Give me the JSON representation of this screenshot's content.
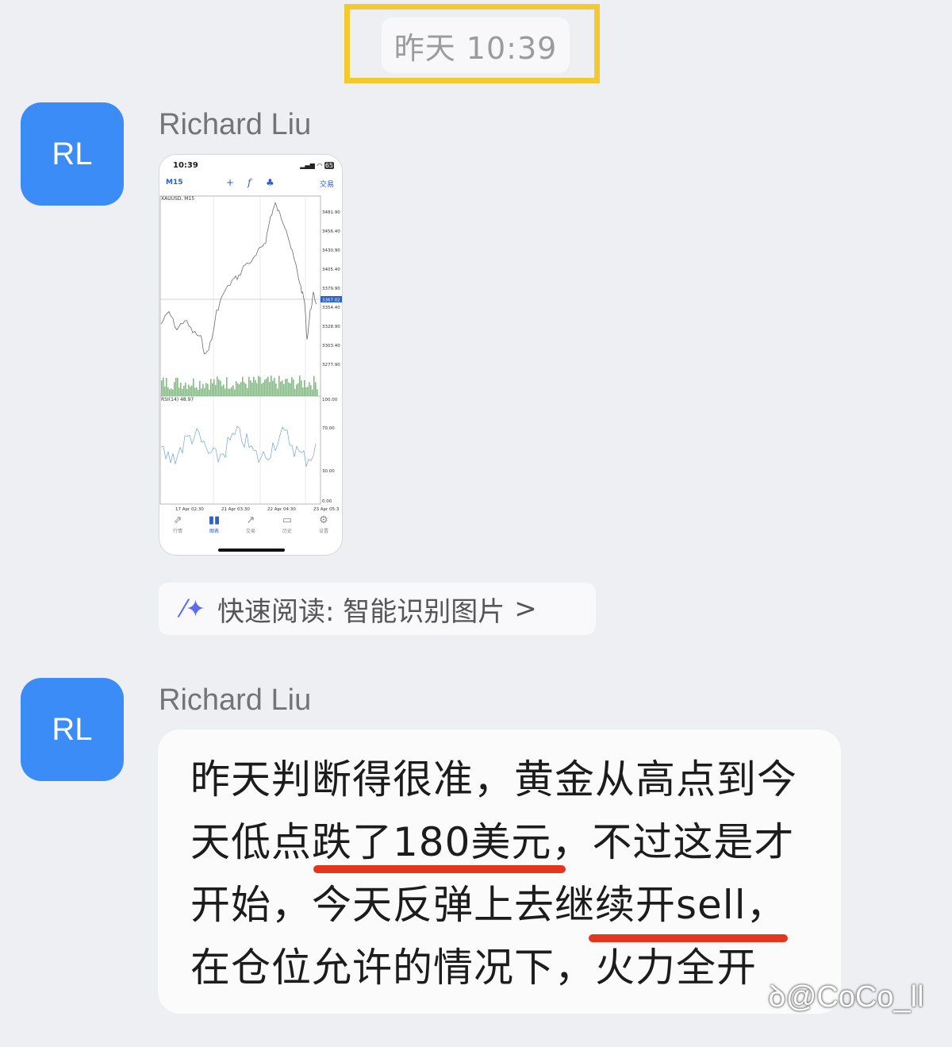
{
  "timestamp": "昨天 10:39",
  "messages": [
    {
      "avatar_initials": "RL",
      "sender": "Richard Liu",
      "image": {
        "status_time": "10:39",
        "status_battery": "65",
        "timeframe": "M15",
        "trade_label": "交易",
        "chart_data": {
          "type": "line",
          "title": "XAUUSD, M15",
          "price_ticks": [
            "3481.90",
            "3456.40",
            "3430.90",
            "3405.40",
            "3379.90",
            "3354.40",
            "3328.90",
            "3303.40",
            "3277.90"
          ],
          "current_price": "3367.02",
          "indicator_title": "RSI(14) 48.97",
          "rsi_ticks": [
            "100.00",
            "70.00",
            "30.00",
            "0.00"
          ],
          "x_ticks": [
            "17 Apr 02:30",
            "21 Apr 03:30",
            "22 Apr 04:30",
            "23 Apr 05:3"
          ]
        },
        "tabs": [
          {
            "label": "行情",
            "icon": "quotes-icon"
          },
          {
            "label": "图表",
            "icon": "chart-icon"
          },
          {
            "label": "交易",
            "icon": "trade-icon"
          },
          {
            "label": "历史",
            "icon": "history-icon"
          },
          {
            "label": "设置",
            "icon": "settings-icon"
          }
        ]
      },
      "quick_read": {
        "label": "快速阅读: 智能识别图片",
        "chevron": ">"
      }
    },
    {
      "avatar_initials": "RL",
      "sender": "Richard Liu",
      "text_lines": [
        "昨天判断得很准，黄金从高点到今",
        "天低点跌了180美元，不过这是才",
        "开始，今天反弹上去继续开sell，",
        "在仓位允许的情况下，火力全开"
      ]
    }
  ],
  "watermark": "@CoCo_ll",
  "colors": {
    "avatar": "#3c8cf7",
    "highlight_frame": "#f2c92e",
    "underline": "#e2361f"
  }
}
